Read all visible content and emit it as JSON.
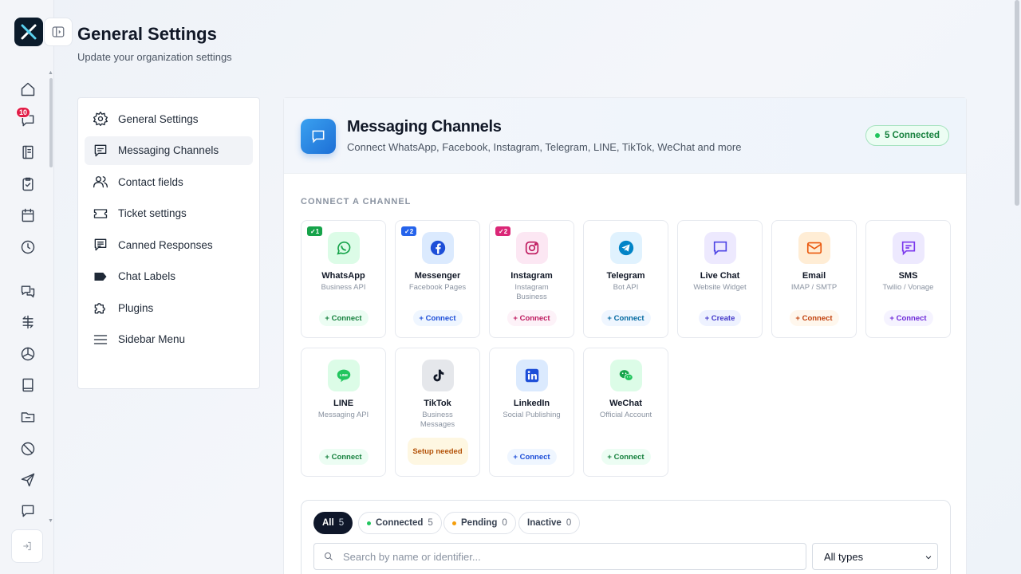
{
  "header": {
    "title": "General Settings",
    "subtitle": "Update your organization settings"
  },
  "rail": {
    "notification_count": "10",
    "icons": [
      "home-icon",
      "inbox-icon",
      "book-icon",
      "clipboard-check-icon",
      "calendar-icon",
      "clock-icon",
      "chat-bubbles-icon",
      "flow-icon",
      "cube-icon",
      "book-open-icon",
      "folder-icon",
      "ban-icon",
      "send-icon",
      "message-icon"
    ]
  },
  "settings_nav": {
    "items": [
      {
        "label": "General Settings",
        "icon": "gear-icon"
      },
      {
        "label": "Messaging Channels",
        "icon": "message-square-icon"
      },
      {
        "label": "Contact fields",
        "icon": "users-icon"
      },
      {
        "label": "Ticket settings",
        "icon": "ticket-icon"
      },
      {
        "label": "Canned Responses",
        "icon": "message-text-icon"
      },
      {
        "label": "Chat Labels",
        "icon": "label-icon"
      },
      {
        "label": "Plugins",
        "icon": "puzzle-icon"
      },
      {
        "label": "Sidebar Menu",
        "icon": "menu-icon"
      }
    ]
  },
  "panel": {
    "title": "Messaging Channels",
    "subtitle": "Connect WhatsApp, Facebook, Instagram, Telegram, LINE, TikTok, WeChat and more",
    "connected_badge": "5 Connected",
    "section_label": "CONNECT A CHANNEL"
  },
  "channels": [
    {
      "name": "WhatsApp",
      "sub": "Business API",
      "action": "+ Connect",
      "badge": "✓1",
      "icon": "whatsapp-icon",
      "color": "#16a34a"
    },
    {
      "name": "Messenger",
      "sub": "Facebook Pages",
      "action": "+ Connect",
      "badge": "✓2",
      "icon": "facebook-icon",
      "color": "#2563eb"
    },
    {
      "name": "Instagram",
      "sub": "Instagram Business",
      "action": "+ Connect",
      "badge": "✓2",
      "icon": "instagram-icon",
      "color": "#db2777"
    },
    {
      "name": "Telegram",
      "sub": "Bot API",
      "action": "+ Connect",
      "icon": "telegram-icon",
      "color": "#0284c7"
    },
    {
      "name": "Live Chat",
      "sub": "Website Widget",
      "action": "+ Create",
      "icon": "chat-widget-icon",
      "color": "#4f46e5"
    },
    {
      "name": "Email",
      "sub": "IMAP / SMTP",
      "action": "+ Connect",
      "icon": "mail-icon",
      "color": "#ea580c"
    },
    {
      "name": "SMS",
      "sub": "Twilio / Vonage",
      "action": "+ Connect",
      "icon": "sms-icon",
      "color": "#7c3aed"
    },
    {
      "name": "LINE",
      "sub": "Messaging API",
      "action": "+ Connect",
      "icon": "line-icon",
      "color": "#16a34a"
    },
    {
      "name": "TikTok",
      "sub": "Business Messages",
      "action": "Setup needed",
      "icon": "tiktok-icon",
      "color": "#111827"
    },
    {
      "name": "LinkedIn",
      "sub": "Social Publishing",
      "action": "+ Connect",
      "icon": "linkedin-icon",
      "color": "#1d4ed8"
    },
    {
      "name": "WeChat",
      "sub": "Official Account",
      "action": "+ Connect",
      "icon": "wechat-icon",
      "color": "#16a34a"
    }
  ],
  "filters": {
    "pills": [
      {
        "label": "All",
        "count": "5"
      },
      {
        "label": "Connected",
        "count": "5"
      },
      {
        "label": "Pending",
        "count": "0"
      },
      {
        "label": "Inactive",
        "count": "0"
      }
    ],
    "search_placeholder": "Search by name or identifier...",
    "type_select": "All types"
  }
}
